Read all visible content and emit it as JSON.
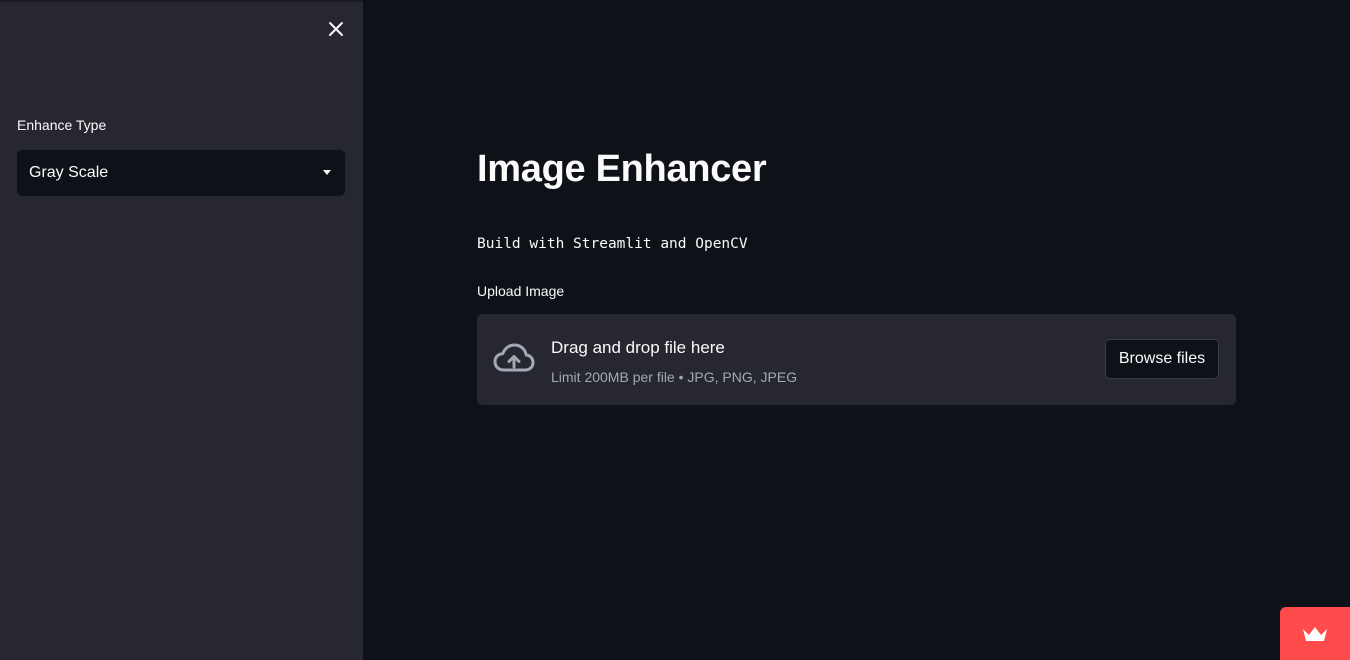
{
  "sidebar": {
    "close_icon": "close-icon",
    "select": {
      "label": "Enhance Type",
      "value": "Gray Scale"
    }
  },
  "main": {
    "title": "Image Enhancer",
    "subtitle": "Build with Streamlit and OpenCV",
    "uploader": {
      "label": "Upload Image",
      "drop_title": "Drag and drop file here",
      "limit": "Limit 200MB per file • JPG, PNG, JPEG",
      "browse_label": "Browse files",
      "icon": "cloud-upload-icon"
    }
  },
  "badge": {
    "icon": "crown-icon",
    "color": "#ff4b4b"
  },
  "colors": {
    "background": "#0e1117",
    "sidebar": "#262730",
    "text": "#fafafa",
    "muted_text": "#a3a8b4"
  }
}
